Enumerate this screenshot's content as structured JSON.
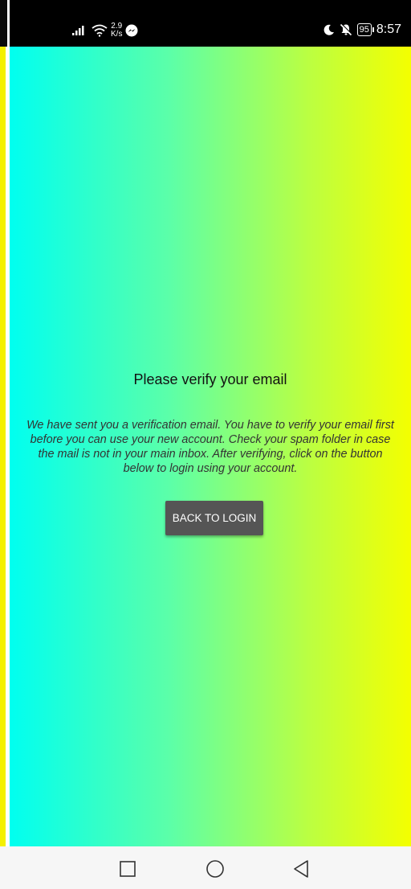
{
  "status_bar": {
    "net_speed_value": "2.9",
    "net_speed_unit": "K/s",
    "battery": "95",
    "time": "8:57",
    "icons": [
      "signal-icon",
      "wifi-icon",
      "messenger-icon",
      "moon-icon",
      "bell-off-icon",
      "battery-icon"
    ]
  },
  "verify": {
    "title": "Please verify your email",
    "message": "We have sent you a verification email. You have to verify your email first before you can use your new account. Check your spam folder in case the mail is not in your main inbox. After verifying, click on the button below to login using your account.",
    "button_label": "BACK TO LOGIN"
  },
  "nav_bar": {
    "icons": [
      "recents-square-icon",
      "home-circle-icon",
      "back-triangle-icon"
    ]
  },
  "colors": {
    "gradient_start": "#00fff0",
    "gradient_end": "#f4ff00",
    "button_bg": "#555555",
    "status_bar_bg": "#000000"
  }
}
